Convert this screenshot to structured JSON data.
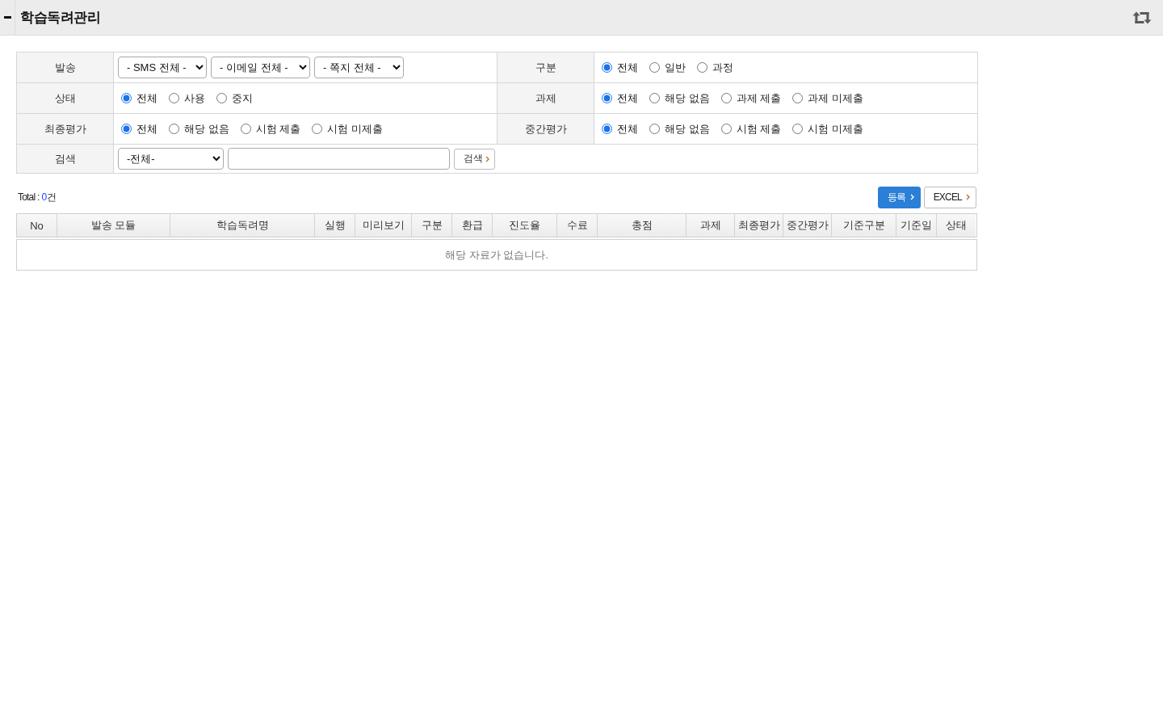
{
  "header": {
    "title": "학습독려관리"
  },
  "filters": [
    [
      {
        "label": "발송",
        "kind": "selects",
        "selects": [
          "- SMS 전체 -",
          "- 이메일 전체 -",
          "- 쪽지 전체 -"
        ]
      },
      {
        "label": "구분",
        "kind": "radios",
        "options": [
          {
            "label": "전체",
            "selected": true
          },
          {
            "label": "일반",
            "selected": false
          },
          {
            "label": "과정",
            "selected": false
          }
        ]
      }
    ],
    [
      {
        "label": "상태",
        "kind": "radios",
        "options": [
          {
            "label": "전체",
            "selected": true
          },
          {
            "label": "사용",
            "selected": false
          },
          {
            "label": "중지",
            "selected": false
          }
        ]
      },
      {
        "label": "과제",
        "kind": "radios",
        "options": [
          {
            "label": "전체",
            "selected": true
          },
          {
            "label": "해당 없음",
            "selected": false
          },
          {
            "label": "과제 제출",
            "selected": false
          },
          {
            "label": "과제 미제출",
            "selected": false
          }
        ]
      }
    ],
    [
      {
        "label": "최종평가",
        "kind": "radios",
        "options": [
          {
            "label": "전체",
            "selected": true
          },
          {
            "label": "해당 없음",
            "selected": false
          },
          {
            "label": "시험 제출",
            "selected": false
          },
          {
            "label": "시험 미제출",
            "selected": false
          }
        ]
      },
      {
        "label": "중간평가",
        "kind": "radios",
        "options": [
          {
            "label": "전체",
            "selected": true
          },
          {
            "label": "해당 없음",
            "selected": false
          },
          {
            "label": "시험 제출",
            "selected": false
          },
          {
            "label": "시험 미제출",
            "selected": false
          }
        ]
      }
    ],
    [
      {
        "label": "검색",
        "kind": "search",
        "select": "-전체-",
        "button": "검색"
      }
    ]
  ],
  "toolbar": {
    "total": {
      "label": "Total :",
      "count": "0",
      "unit": "건"
    },
    "buttons": [
      {
        "label": "등록",
        "kind": "primary"
      },
      {
        "label": "EXCEL",
        "kind": "default"
      }
    ]
  },
  "table": {
    "columns": [
      "No",
      "발송 모듈",
      "학습독려명",
      "실행",
      "미리보기",
      "구분",
      "환급",
      "진도율",
      "수료",
      "총점",
      "과제",
      "최종평가",
      "중간평가",
      "기준구분",
      "기준일",
      "상태"
    ],
    "empty_message": "해당 자료가 없습니다."
  }
}
